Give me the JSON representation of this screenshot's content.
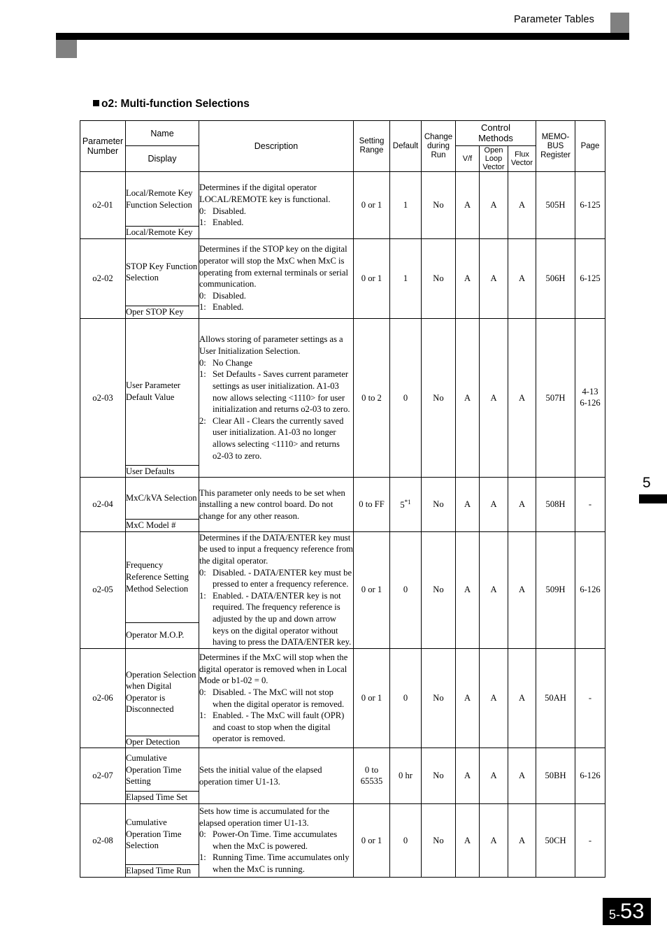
{
  "header": {
    "title": "Parameter Tables"
  },
  "section": {
    "heading": "o2: Multi-function Selections"
  },
  "chapter": {
    "number": "5"
  },
  "footer": {
    "page_prefix": "5-",
    "page_main": "53"
  },
  "table": {
    "headers": {
      "parameter_number": "Parameter\nNumber",
      "name": "Name",
      "display": "Display",
      "description": "Description",
      "setting_range": "Setting\nRange",
      "default": "Default",
      "change_during_run": "Change\nduring\nRun",
      "control_methods": "Control\nMethods",
      "vf": "V/f",
      "open_loop_vector": "Open\nLoop\nVector",
      "flux_vector": "Flux\nVector",
      "memobus_register": "MEMO-\nBUS\nRegister",
      "page": "Page"
    },
    "rows": [
      {
        "parameter": "o2-01",
        "name": "Local/Remote Key Function Selection",
        "display": "Local/Remote Key",
        "description_intro": "Determines if the digital operator LOCAL/REMOTE key is functional.",
        "options": [
          {
            "key": "0:",
            "text": "Disabled."
          },
          {
            "key": "1:",
            "text": "Enabled."
          }
        ],
        "setting_range": "0 or 1",
        "default": "1",
        "default_footnote": "",
        "change_during_run": "No",
        "vf": "A",
        "open_loop_vector": "A",
        "flux_vector": "A",
        "memobus_register": "505H",
        "page": "6-125"
      },
      {
        "parameter": "o2-02",
        "name": "STOP Key Function Selection",
        "display": "Oper STOP Key",
        "description_intro": "Determines if the STOP key on the digital operator will stop the MxC when MxC is operating from external terminals or serial communication.",
        "options": [
          {
            "key": "0:",
            "text": "Disabled."
          },
          {
            "key": "1:",
            "text": "Enabled."
          }
        ],
        "setting_range": "0 or 1",
        "default": "1",
        "default_footnote": "",
        "change_during_run": "No",
        "vf": "A",
        "open_loop_vector": "A",
        "flux_vector": "A",
        "memobus_register": "506H",
        "page": "6-125"
      },
      {
        "parameter": "o2-03",
        "name": "User Parameter Default Value",
        "display": "User Defaults",
        "description_intro": "Allows storing of parameter settings as a User Initialization Selection.",
        "options": [
          {
            "key": "0:",
            "text": "No Change"
          },
          {
            "key": "1:",
            "text": "Set Defaults - Saves current parameter settings as user initialization. A1-03 now allows selecting <1110> for user initialization and returns o2-03 to zero."
          },
          {
            "key": "2:",
            "text": "Clear All - Clears the currently saved user initialization. A1-03 no longer allows selecting <1110> and returns o2-03 to zero."
          }
        ],
        "setting_range": "0 to 2",
        "default": "0",
        "default_footnote": "",
        "change_during_run": "No",
        "vf": "A",
        "open_loop_vector": "A",
        "flux_vector": "A",
        "memobus_register": "507H",
        "page": "4-13\n6-126"
      },
      {
        "parameter": "o2-04",
        "name": "MxC/kVA Selection",
        "display": "MxC Model #",
        "description_intro": "This parameter only needs to be set when installing a new control board. Do not change for any other reason.",
        "options": [],
        "setting_range": "0 to FF",
        "default": "5",
        "default_footnote": "*1",
        "change_during_run": "No",
        "vf": "A",
        "open_loop_vector": "A",
        "flux_vector": "A",
        "memobus_register": "508H",
        "page": "-"
      },
      {
        "parameter": "o2-05",
        "name": "Frequency Reference Setting Method Selection",
        "display": "Operator M.O.P.",
        "description_intro": "Determines if the DATA/ENTER key must be used to input a frequency reference from the digital operator.",
        "options": [
          {
            "key": "0:",
            "text": "Disabled. - DATA/ENTER key must be pressed to enter a frequency reference."
          },
          {
            "key": "1:",
            "text": "Enabled. - DATA/ENTER key is not required. The frequency reference is adjusted by the up and down arrow keys on the digital operator without having to press the DATA/ENTER key."
          }
        ],
        "setting_range": "0 or 1",
        "default": "0",
        "default_footnote": "",
        "change_during_run": "No",
        "vf": "A",
        "open_loop_vector": "A",
        "flux_vector": "A",
        "memobus_register": "509H",
        "page": "6-126"
      },
      {
        "parameter": "o2-06",
        "name": "Operation Selection when Digital Operator is Disconnected",
        "display": "Oper Detection",
        "description_intro": "Determines if the MxC will stop when the digital operator is removed when in Local Mode or b1-02 = 0.",
        "options": [
          {
            "key": "0:",
            "text": "Disabled. - The MxC will not stop when the digital operator is removed."
          },
          {
            "key": "1:",
            "text": "Enabled. - The MxC will fault (OPR) and coast to stop when the digital operator is removed."
          }
        ],
        "setting_range": "0 or 1",
        "default": "0",
        "default_footnote": "",
        "change_during_run": "No",
        "vf": "A",
        "open_loop_vector": "A",
        "flux_vector": "A",
        "memobus_register": "50AH",
        "page": "-"
      },
      {
        "parameter": "o2-07",
        "name": "Cumulative Operation Time Setting",
        "display": "Elapsed Time Set",
        "description_intro": "Sets the initial value of the elapsed operation timer U1-13.",
        "options": [],
        "setting_range": "0 to\n65535",
        "default": "0 hr",
        "default_footnote": "",
        "change_during_run": "No",
        "vf": "A",
        "open_loop_vector": "A",
        "flux_vector": "A",
        "memobus_register": "50BH",
        "page": "6-126"
      },
      {
        "parameter": "o2-08",
        "name": "Cumulative Operation Time Selection",
        "display": "Elapsed Time Run",
        "description_intro": "Sets how time is accumulated for the elapsed operation timer U1-13.",
        "options": [
          {
            "key": "0:",
            "text": "Power-On Time. Time accumulates when the MxC is powered."
          },
          {
            "key": "1:",
            "text": "Running Time. Time accumulates only when the MxC is running."
          }
        ],
        "setting_range": "0 or 1",
        "default": "0",
        "default_footnote": "",
        "change_during_run": "No",
        "vf": "A",
        "open_loop_vector": "A",
        "flux_vector": "A",
        "memobus_register": "50CH",
        "page": "-"
      }
    ]
  }
}
